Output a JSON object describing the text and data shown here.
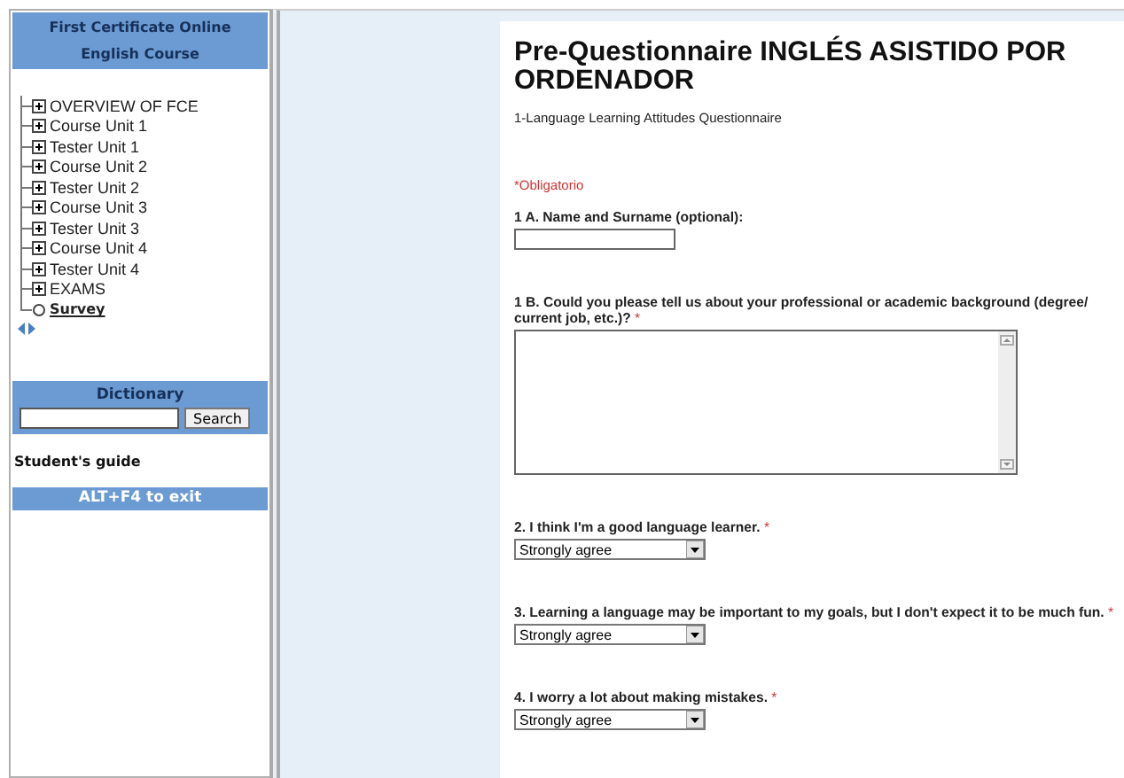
{
  "sidebar": {
    "header": "First Certificate Online English Course",
    "tree": [
      {
        "label": "OVERVIEW OF FCE",
        "kind": "folder",
        "selected": false
      },
      {
        "label": "Course Unit 1",
        "kind": "folder",
        "selected": false
      },
      {
        "label": "Tester Unit 1",
        "kind": "folder",
        "selected": false
      },
      {
        "label": "Course Unit 2",
        "kind": "folder",
        "selected": false
      },
      {
        "label": "Tester Unit 2",
        "kind": "folder",
        "selected": false
      },
      {
        "label": "Course Unit 3",
        "kind": "folder",
        "selected": false
      },
      {
        "label": "Tester Unit 3",
        "kind": "folder",
        "selected": false
      },
      {
        "label": "Course Unit 4",
        "kind": "folder",
        "selected": false
      },
      {
        "label": "Tester Unit 4",
        "kind": "folder",
        "selected": false
      },
      {
        "label": "EXAMS",
        "kind": "folder",
        "selected": false
      },
      {
        "label": "Survey",
        "kind": "leaf",
        "selected": true
      }
    ],
    "dictionary": {
      "title": "Dictionary",
      "button": "Search"
    },
    "guide_link": "Student's guide",
    "exit_banner": "ALT+F4 to exit"
  },
  "form": {
    "title": "Pre-Questionnaire INGLÉS ASISTIDO POR ORDENADOR",
    "subtitle": "1-Language Learning Attitudes Questionnaire",
    "required_note": "*Obligatorio",
    "questions": [
      {
        "kind": "text",
        "label": "1 A. Name and Surname (optional):"
      },
      {
        "kind": "textarea",
        "label": "1 B. Could you please tell us about your professional or academic background (degree/ current job, etc.)?",
        "required_mark": "*"
      },
      {
        "kind": "select",
        "label": "2. I think I'm a good language learner.",
        "required_mark": "*",
        "value": "Strongly agree"
      },
      {
        "kind": "select",
        "label": "3. Learning a language may be important to my goals, but I don't expect it to be much fun.",
        "required_mark": "*",
        "value": "Strongly agree"
      },
      {
        "kind": "select",
        "label": "4. I worry a lot about making mistakes.",
        "required_mark": "*",
        "value": "Strongly agree"
      }
    ]
  }
}
